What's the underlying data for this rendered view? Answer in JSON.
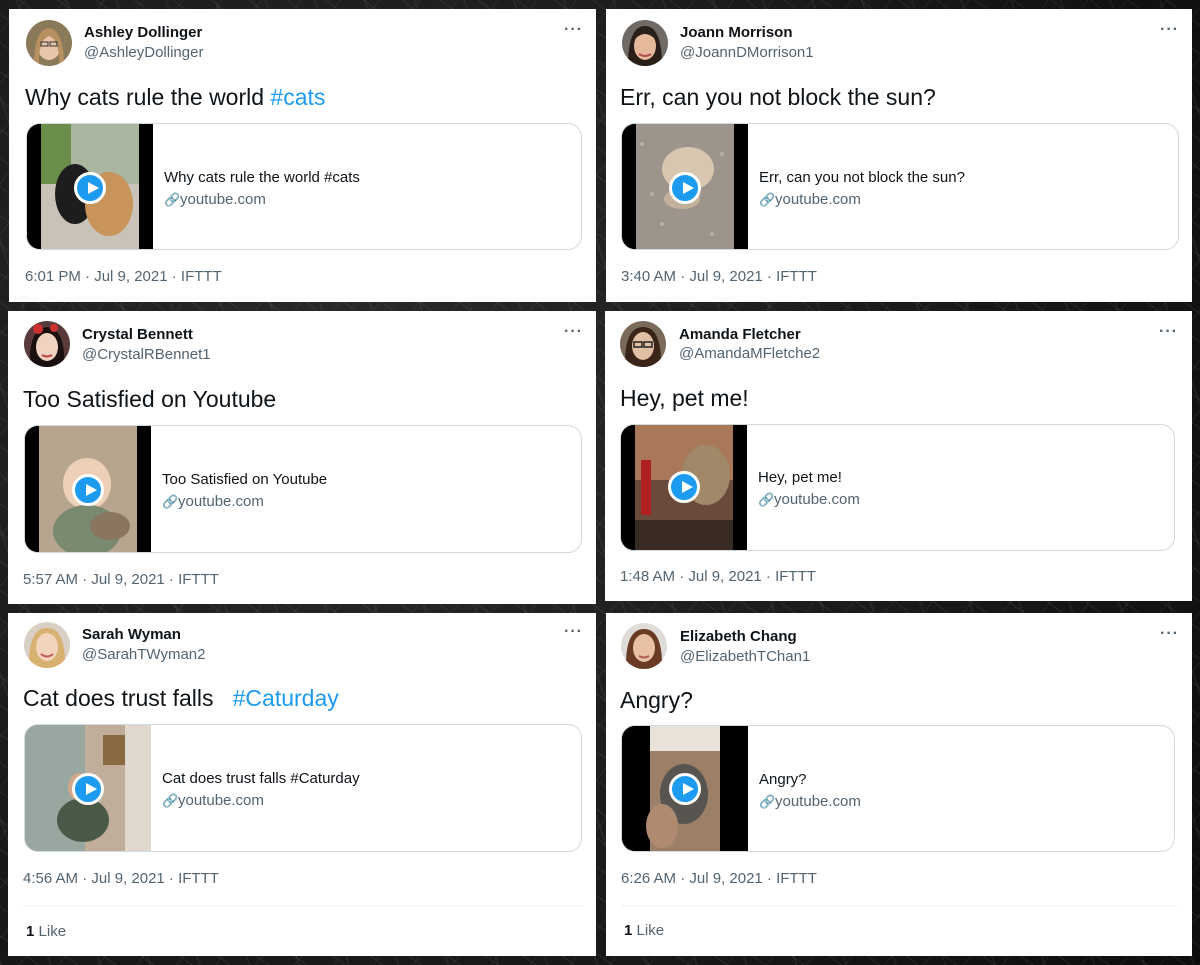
{
  "tweets": [
    {
      "name": "Ashley Dollinger",
      "handle": "@AshleyDollinger",
      "text": "Why cats rule the world ",
      "hashtag": "#cats",
      "card_title": "Why cats rule the world #cats",
      "card_domain": "youtube.com",
      "timestamp": "6:01 PM · Jul 9, 2021 · IFTTT"
    },
    {
      "name": "Joann Morrison",
      "handle": "@JoannDMorrison1",
      "text": "Err, can you not block the sun?",
      "hashtag": "",
      "card_title": "Err, can you not block the sun?",
      "card_domain": "youtube.com",
      "timestamp": "3:40 AM · Jul 9, 2021 · IFTTT"
    },
    {
      "name": "Crystal Bennett",
      "handle": "@CrystalRBennet1",
      "text": "Too Satisfied on Youtube",
      "hashtag": "",
      "card_title": "Too Satisfied on Youtube",
      "card_domain": "youtube.com",
      "timestamp": "5:57 AM · Jul 9, 2021 · IFTTT"
    },
    {
      "name": "Amanda Fletcher",
      "handle": "@AmandaMFletche2",
      "text": "Hey, pet me!",
      "hashtag": "",
      "card_title": "Hey, pet me!",
      "card_domain": "youtube.com",
      "timestamp": "1:48 AM · Jul 9, 2021 · IFTTT"
    },
    {
      "name": "Sarah Wyman",
      "handle": "@SarahTWyman2",
      "text": "Cat does trust falls   ",
      "hashtag": "#Caturday",
      "card_title": "Cat does trust falls #Caturday",
      "card_domain": "youtube.com",
      "timestamp": "4:56 AM · Jul 9, 2021 · IFTTT",
      "like_count": "1",
      "like_label": "Like"
    },
    {
      "name": "Elizabeth Chang",
      "handle": "@ElizabethTChan1",
      "text": "Angry?",
      "hashtag": "",
      "card_title": "Angry?",
      "card_domain": "youtube.com",
      "timestamp": "6:26 AM · Jul 9, 2021 · IFTTT",
      "like_count": "1",
      "like_label": "Like"
    }
  ],
  "icons": {
    "more": "more-horizontal-icon",
    "link": "link-icon",
    "play": "play-icon"
  },
  "colors": {
    "accent": "#1d9bf0",
    "text": "#0f1419",
    "secondary": "#536471",
    "border": "#cfd9de"
  }
}
